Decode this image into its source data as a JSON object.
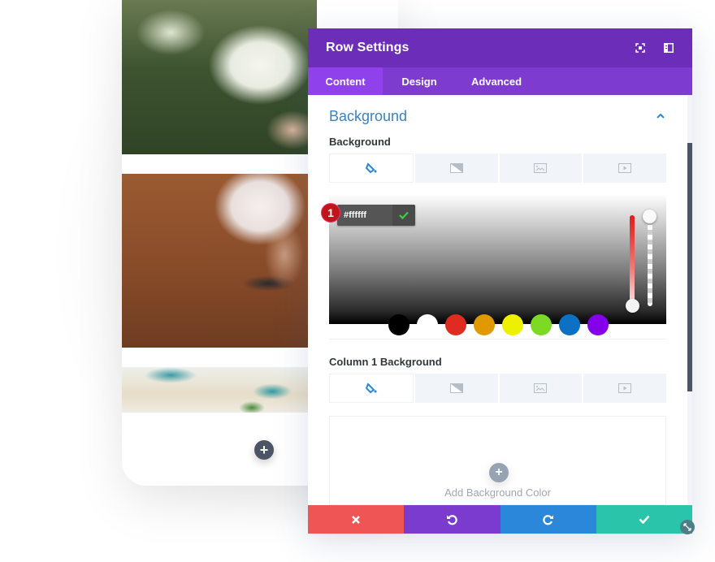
{
  "modal": {
    "title": "Row Settings",
    "header_icons": [
      "focus-icon",
      "sidebar-layout-icon"
    ],
    "tabs": [
      {
        "label": "Content",
        "active": true
      },
      {
        "label": "Design",
        "active": false
      },
      {
        "label": "Advanced",
        "active": false
      }
    ],
    "section": {
      "title": "Background",
      "expanded": true
    },
    "background": {
      "label": "Background",
      "type_tabs": [
        {
          "icon": "paint-bucket-icon",
          "active": true
        },
        {
          "icon": "gradient-icon",
          "active": false
        },
        {
          "icon": "image-icon",
          "active": false
        },
        {
          "icon": "video-icon",
          "active": false
        }
      ],
      "color_picker": {
        "hex_value": "#ffffff",
        "step_badge": "1",
        "swatches": [
          "#000000",
          "#ffffff",
          "#e02b20",
          "#e09900",
          "#edf000",
          "#7cda24",
          "#0c71c3",
          "#8300e9"
        ]
      }
    },
    "column_background": {
      "label": "Column 1 Background",
      "type_tabs": [
        {
          "icon": "paint-bucket-icon",
          "active": true
        },
        {
          "icon": "gradient-icon",
          "active": false
        },
        {
          "icon": "image-icon",
          "active": false
        },
        {
          "icon": "video-icon",
          "active": false
        }
      ],
      "add_label": "Add Background Color"
    },
    "footer": {
      "cancel": "cancel-icon",
      "undo": "undo-icon",
      "redo": "redo-icon",
      "save": "save-icon"
    }
  },
  "preview": {
    "add_module": "+"
  },
  "colors": {
    "header": "#6c2eb9",
    "tabs": "#7e3bd0",
    "tab_active": "#8f42ec",
    "cancel": "#ef5555",
    "undo": "#7b3bcf",
    "redo": "#2b87da",
    "save": "#29c4a9"
  }
}
